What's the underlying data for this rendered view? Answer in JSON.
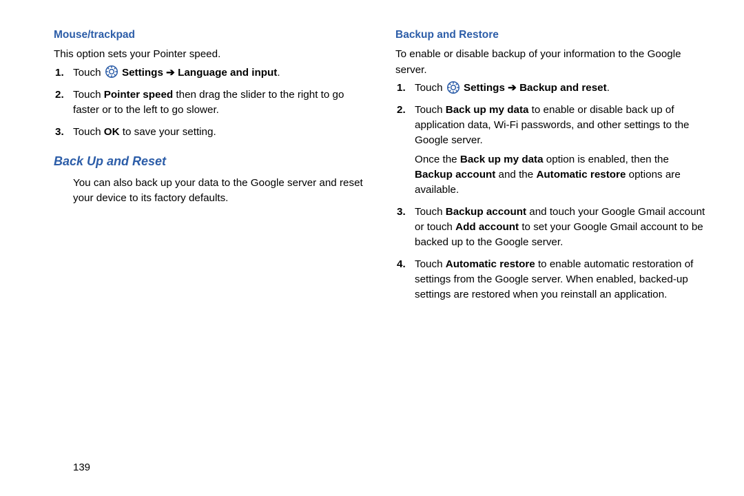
{
  "pageNumber": "139",
  "left": {
    "h1": "Mouse/trackpad",
    "intro": "This option sets your Pointer speed.",
    "s1_pre": "Touch ",
    "s1_b1": "Settings",
    "s1_arrow": " ➔ ",
    "s1_b2": "Language and input",
    "s1_post": ".",
    "s2_pre": "Touch ",
    "s2_b": "Pointer speed",
    "s2_post": " then drag the slider to the right to go faster or to the left to go slower.",
    "s3_pre": "Touch ",
    "s3_b": "OK",
    "s3_post": " to save your setting.",
    "h2": "Back Up and Reset",
    "para2": "You can also back up your data to the Google server and reset your device to its factory defaults."
  },
  "right": {
    "h1": "Backup and Restore",
    "intro": "To enable or disable backup of your information to the Google server.",
    "s1_pre": "Touch ",
    "s1_b1": "Settings",
    "s1_arrow": " ➔ ",
    "s1_b2": "Backup and reset",
    "s1_post": ".",
    "s2_pre": "Touch ",
    "s2_b": "Back up my data",
    "s2_post": " to enable or disable back up of application data, Wi-Fi passwords, and other settings to the Google server.",
    "s2b_pre": "Once the ",
    "s2b_b1": "Back up my data",
    "s2b_mid": " option is enabled, then the ",
    "s2b_b2": "Backup account",
    "s2b_mid2": " and the ",
    "s2b_b3": "Automatic restore",
    "s2b_post": " options are available.",
    "s3_pre": "Touch ",
    "s3_b1": "Backup account",
    "s3_mid": " and touch your Google Gmail account or touch ",
    "s3_b2": "Add account",
    "s3_post": " to set your Google Gmail account to be backed up to the Google server.",
    "s4_pre": "Touch ",
    "s4_b": "Automatic restore",
    "s4_post": " to enable automatic restoration of settings from the Google server. When enabled, backed-up settings are restored when you reinstall an application."
  }
}
